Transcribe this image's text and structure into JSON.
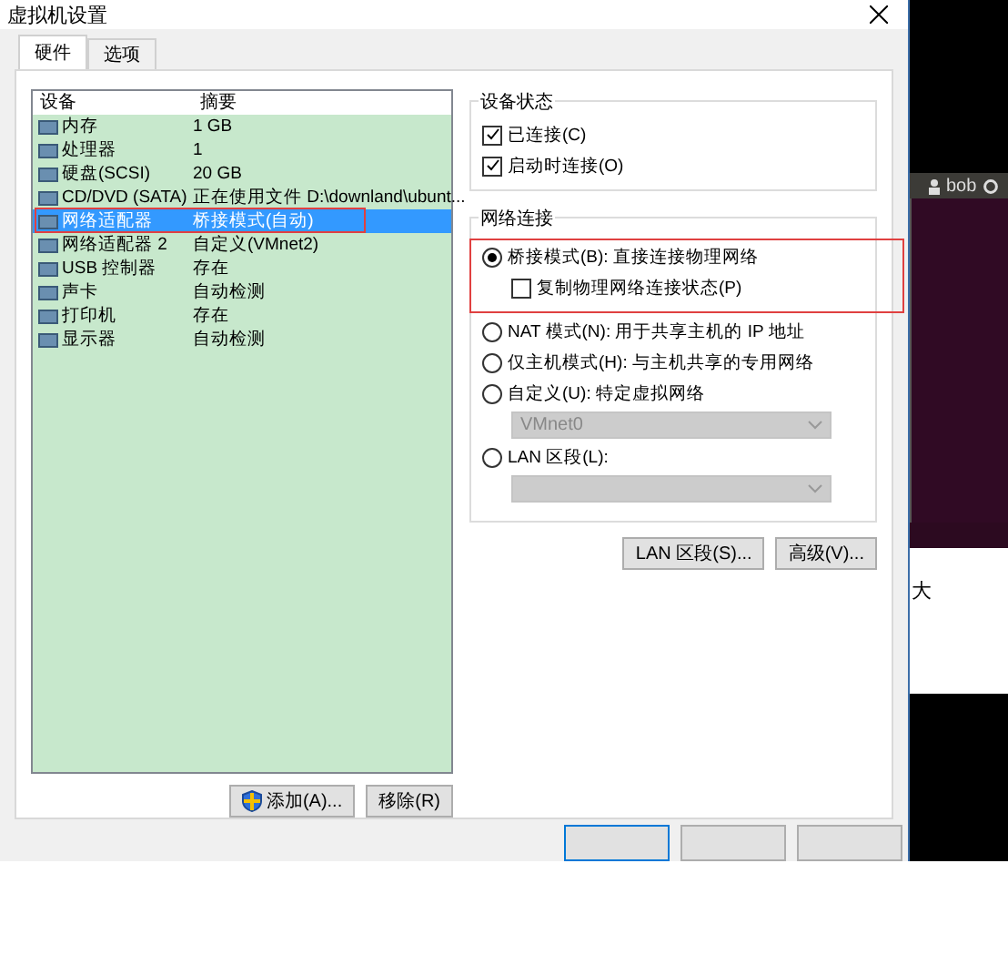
{
  "window": {
    "title": "虚拟机设置"
  },
  "tabs": [
    {
      "label": "硬件",
      "selected": true
    },
    {
      "label": "选项",
      "selected": false
    }
  ],
  "devices": {
    "columns": [
      "设备",
      "摘要"
    ],
    "rows": [
      {
        "name": "内存",
        "summary": "1 GB",
        "selected": false
      },
      {
        "name": "处理器",
        "summary": "1",
        "selected": false
      },
      {
        "name": "硬盘(SCSI)",
        "summary": "20 GB",
        "selected": false
      },
      {
        "name": "CD/DVD (SATA)",
        "summary": "正在使用文件 D:\\downland\\ubunt...",
        "selected": false
      },
      {
        "name": "网络适配器",
        "summary": "桥接模式(自动)",
        "selected": true
      },
      {
        "name": "网络适配器 2",
        "summary": "自定义(VMnet2)",
        "selected": false
      },
      {
        "name": "USB 控制器",
        "summary": "存在",
        "selected": false
      },
      {
        "name": "声卡",
        "summary": "自动检测",
        "selected": false
      },
      {
        "name": "打印机",
        "summary": "存在",
        "selected": false
      },
      {
        "name": "显示器",
        "summary": "自动检测",
        "selected": false
      }
    ]
  },
  "list_buttons": [
    "添加(A)...",
    "移除(R)"
  ],
  "device_status": {
    "title": "设备状态",
    "options": [
      {
        "label": "已连接(C)",
        "checked": true
      },
      {
        "label": "启动时连接(O)",
        "checked": true
      }
    ]
  },
  "network": {
    "title": "网络连接",
    "options": [
      {
        "kind": "radio",
        "label": "桥接模式(B): 直接连接物理网络",
        "selected": true
      },
      {
        "kind": "checkbox",
        "label": "复制物理网络连接状态(P)",
        "checked": false
      },
      {
        "kind": "radio",
        "label": "NAT 模式(N): 用于共享主机的 IP 地址",
        "selected": false
      },
      {
        "kind": "radio",
        "label": "仅主机模式(H): 与主机共享的专用网络",
        "selected": false
      },
      {
        "kind": "radio",
        "label": "自定义(U): 特定虚拟网络",
        "selected": false
      },
      {
        "kind": "select",
        "value": "VMnet0",
        "disabled": true
      },
      {
        "kind": "radio",
        "label": "LAN 区段(L):",
        "selected": false
      },
      {
        "kind": "select",
        "disabled": true
      }
    ]
  },
  "network_buttons": [
    "LAN 区段(S)...",
    "高级(V)..."
  ],
  "background": {
    "user": "bob",
    "text": "大"
  }
}
